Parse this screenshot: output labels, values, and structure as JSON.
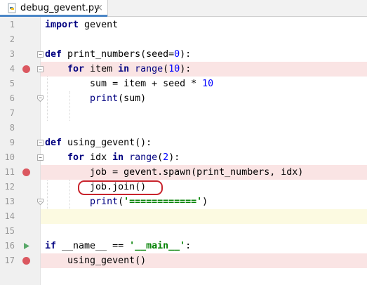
{
  "tab": {
    "filename": "debug_gevent.py",
    "close_glyph": "×",
    "icon": "python-file-icon"
  },
  "colors": {
    "breakpoint": "#db5860",
    "breakpoint_line": "#fae4e4",
    "current_line": "#fcfae1",
    "annotation": "#c8232c",
    "keyword": "#000080",
    "number": "#0000ff",
    "string": "#008000"
  },
  "lines": [
    {
      "n": "1",
      "kw1": "import",
      "t1": " gevent"
    },
    {
      "n": "2"
    },
    {
      "n": "3",
      "kw1": "def",
      "t1": " print_numbers(seed=",
      "num1": "0",
      "t2": "):"
    },
    {
      "n": "4",
      "pre": "    ",
      "kw1": "for",
      "t1": " item ",
      "kw2": "in",
      "t2": " ",
      "fn1": "range",
      "t3": "(",
      "num1": "10",
      "t4": "):"
    },
    {
      "n": "5",
      "t1": "        sum = item + seed * ",
      "num1": "10"
    },
    {
      "n": "6",
      "t1": "        ",
      "fn1": "print",
      "t2": "(sum)"
    },
    {
      "n": "7"
    },
    {
      "n": "8"
    },
    {
      "n": "9",
      "kw1": "def",
      "t1": " using_gevent():"
    },
    {
      "n": "10",
      "pre": "    ",
      "kw1": "for",
      "t1": " idx ",
      "kw2": "in",
      "t2": " ",
      "fn1": "range",
      "t3": "(",
      "num1": "2",
      "t4": "):"
    },
    {
      "n": "11",
      "t1": "        job = gevent.spawn(print_numbers, idx)"
    },
    {
      "n": "12",
      "t1": "        job.join()"
    },
    {
      "n": "13",
      "t1": "        ",
      "fn1": "print",
      "t2": "(",
      "str1": "'============'",
      "t3": ")"
    },
    {
      "n": "14"
    },
    {
      "n": "15"
    },
    {
      "n": "16",
      "kw1": "if",
      "t1": " __name__ == ",
      "str1": "'__main__'",
      "t2": ":"
    },
    {
      "n": "17",
      "t1": "    using_gevent()"
    }
  ]
}
